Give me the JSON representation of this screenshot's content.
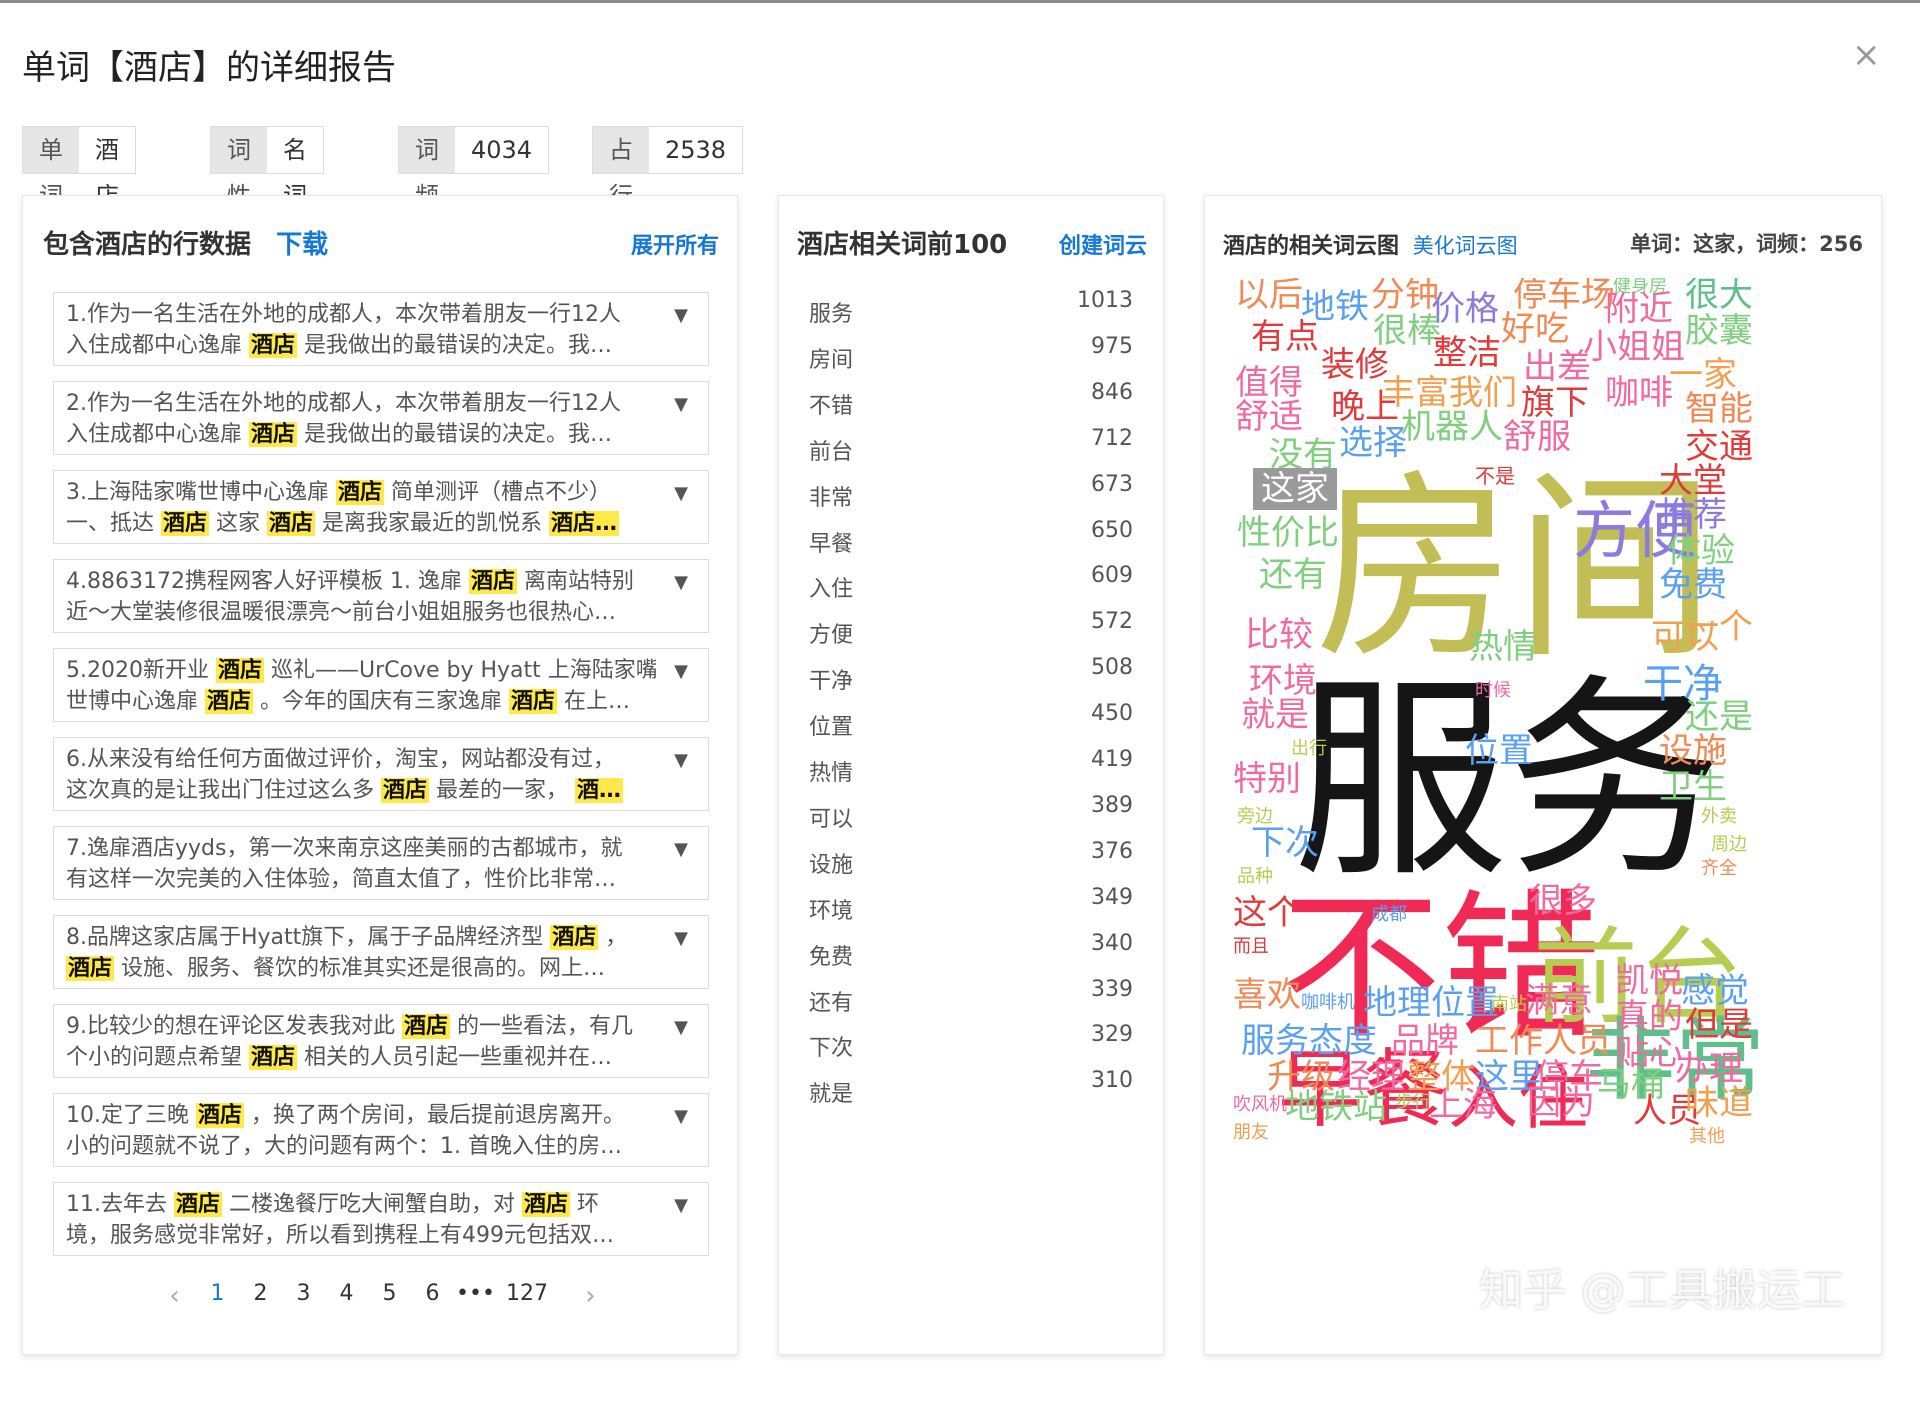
{
  "dialog": {
    "title": "单词【酒店】的详细报告",
    "close": "×"
  },
  "tags": [
    {
      "key": "单词",
      "value": "酒店"
    },
    {
      "key": "词性",
      "value": "名词"
    },
    {
      "key": "词频",
      "value": "4034"
    },
    {
      "key": "占行数",
      "value": "2538"
    }
  ],
  "lines_panel": {
    "title": "包含酒店的行数据",
    "download": "下载",
    "expand_all": "展开所有",
    "rows": [
      {
        "l1": [
          "1.作为一名生活在外地的成都人，本次带着朋友一行12人"
        ],
        "l2": [
          "入住成都中心逸扉 ",
          "#酒店",
          " 是我做出的最错误的决定。我…"
        ]
      },
      {
        "l1": [
          "2.作为一名生活在外地的成都人，本次带着朋友一行12人"
        ],
        "l2": [
          "入住成都中心逸扉 ",
          "#酒店",
          " 是我做出的最错误的决定。我…"
        ]
      },
      {
        "l1": [
          "3.上海陆家嘴世博中心逸扉 ",
          "#酒店",
          " 简单测评（槽点不少）"
        ],
        "l2": [
          "一、抵达 ",
          "#酒店",
          " 这家 ",
          "#酒店",
          " 是离我家最近的凯悦系 ",
          "#酒店…"
        ]
      },
      {
        "l1": [
          "4.8863172携程网客人好评模板 1. 逸扉 ",
          "#酒店",
          " 离南站特别"
        ],
        "l2": [
          "近～大堂装修很温暖很漂亮～前台小姐姐服务也很热心…"
        ]
      },
      {
        "l1": [
          "5.2020新开业 ",
          "#酒店",
          " 巡礼——UrCove by Hyatt 上海陆家嘴"
        ],
        "l2": [
          "世博中心逸扉 ",
          "#酒店",
          " 。今年的国庆有三家逸扉 ",
          "#酒店",
          " 在上…"
        ]
      },
      {
        "l1": [
          "6.从来没有给任何方面做过评价，淘宝，网站都没有过，"
        ],
        "l2": [
          "这次真的是让我出门住过这么多 ",
          "#酒店",
          " 最差的一家， ",
          "#酒…"
        ]
      },
      {
        "l1": [
          "7.逸扉酒店yyds，第一次来南京这座美丽的古都城市，就"
        ],
        "l2": [
          "有这样一次完美的入住体验，简直太值了，性价比非常…"
        ]
      },
      {
        "l1": [
          "8.品牌这家店属于Hyatt旗下，属于子品牌经济型 ",
          "#酒店",
          " ，"
        ],
        "l2": [
          "#酒店",
          " 设施、服务、餐饮的标准其实还是很高的。网上…"
        ]
      },
      {
        "l1": [
          "9.比较少的想在评论区发表我对此 ",
          "#酒店",
          " 的一些看法，有几"
        ],
        "l2": [
          "个小的问题点希望 ",
          "#酒店",
          " 相关的人员引起一些重视并在…"
        ]
      },
      {
        "l1": [
          "10.定了三晚 ",
          "#酒店",
          " ，换了两个房间，最后提前退房离开。"
        ],
        "l2": [
          "小的问题就不说了，大的问题有两个：1. 首晚入住的房…"
        ]
      },
      {
        "l1": [
          "11.去年去 ",
          "#酒店",
          " 二楼逸餐厅吃大闸蟹自助，对 ",
          "#酒店",
          " 环"
        ],
        "l2": [
          "境，服务感觉非常好，所以看到携程上有499元包括双…"
        ]
      }
    ],
    "pagination": {
      "prev": "‹",
      "pages": [
        "1",
        "2",
        "3",
        "4",
        "5",
        "6",
        "•••",
        "127"
      ],
      "next": "›",
      "current": "1"
    }
  },
  "related_panel": {
    "title": "酒店相关词前100",
    "create_cloud": "创建词云",
    "words": [
      {
        "word": "服务",
        "count": "1013"
      },
      {
        "word": "房间",
        "count": "975"
      },
      {
        "word": "不错",
        "count": "846"
      },
      {
        "word": "前台",
        "count": "712"
      },
      {
        "word": "非常",
        "count": "673"
      },
      {
        "word": "早餐",
        "count": "650"
      },
      {
        "word": "入住",
        "count": "609"
      },
      {
        "word": "方便",
        "count": "572"
      },
      {
        "word": "干净",
        "count": "508"
      },
      {
        "word": "位置",
        "count": "450"
      },
      {
        "word": "热情",
        "count": "419"
      },
      {
        "word": "可以",
        "count": "389"
      },
      {
        "word": "设施",
        "count": "376"
      },
      {
        "word": "环境",
        "count": "349"
      },
      {
        "word": "免费",
        "count": "340"
      },
      {
        "word": "还有",
        "count": "339"
      },
      {
        "word": "下次",
        "count": "329"
      },
      {
        "word": "就是",
        "count": "310"
      }
    ]
  },
  "cloud_panel": {
    "title": "酒店的相关词云图",
    "beautify": "美化词云图",
    "hover_info": "单词：这家，词频：256",
    "hovered_word": "这家",
    "watermark": "知乎 @工具搬运工",
    "words": [
      {
        "t": "房间",
        "c": "#c2bd55"
      },
      {
        "t": "服务",
        "c": "#151515"
      },
      {
        "t": "不错",
        "c": "#ee2a55"
      },
      {
        "t": "前台",
        "c": "#b5cd50"
      },
      {
        "t": "早餐",
        "c": "#ee2a55"
      },
      {
        "t": "入住",
        "c": "#ee2a55"
      },
      {
        "t": "非常",
        "c": "#5fbf8a"
      },
      {
        "t": "方便",
        "c": "#8a7be0"
      },
      {
        "t": "以后",
        "c": "#f08a55"
      },
      {
        "t": "地铁",
        "c": "#5aa0f0"
      },
      {
        "t": "分钟",
        "c": "#f08a55"
      },
      {
        "t": "价格",
        "c": "#8a7be0"
      },
      {
        "t": "停车场",
        "c": "#f08a55"
      },
      {
        "t": "健身房",
        "c": "#7fcf7f"
      },
      {
        "t": "很大",
        "c": "#5fbf8a"
      },
      {
        "t": "有点",
        "c": "#e03a3a"
      },
      {
        "t": "很棒",
        "c": "#7fcf7f"
      },
      {
        "t": "好吃",
        "c": "#f08a55"
      },
      {
        "t": "附近",
        "c": "#f06aa0"
      },
      {
        "t": "胶囊",
        "c": "#7fcf7f"
      },
      {
        "t": "装修",
        "c": "#e03a3a"
      },
      {
        "t": "整洁",
        "c": "#e03a3a"
      },
      {
        "t": "出差",
        "c": "#f06aa0"
      },
      {
        "t": "小姐姐",
        "c": "#f06aa0"
      },
      {
        "t": "值得",
        "c": "#f06aa0"
      },
      {
        "t": "丰富",
        "c": "#f0a050"
      },
      {
        "t": "我们",
        "c": "#f0a050"
      },
      {
        "t": "旗下",
        "c": "#e03a3a"
      },
      {
        "t": "咖啡",
        "c": "#f06aa0"
      },
      {
        "t": "一家",
        "c": "#f0a050"
      },
      {
        "t": "舒适",
        "c": "#f06aa0"
      },
      {
        "t": "晚上",
        "c": "#e03a3a"
      },
      {
        "t": "机器人",
        "c": "#7fcf7f"
      },
      {
        "t": "舒服",
        "c": "#f06aa0"
      },
      {
        "t": "智能",
        "c": "#f08a55"
      },
      {
        "t": "没有",
        "c": "#7fcf7f"
      },
      {
        "t": "选择",
        "c": "#5aa0f0"
      },
      {
        "t": "交通",
        "c": "#e03a3a"
      },
      {
        "t": "这家",
        "c": "#ffffff"
      },
      {
        "t": "不是",
        "c": "#e03a3a"
      },
      {
        "t": "大堂",
        "c": "#e03a3a"
      },
      {
        "t": "性价比",
        "c": "#7fcf7f"
      },
      {
        "t": "推荐",
        "c": "#8a7be0"
      },
      {
        "t": "体验",
        "c": "#7fcf7f"
      },
      {
        "t": "还有",
        "c": "#7fcf7f"
      },
      {
        "t": "免费",
        "c": "#5aa0f0"
      },
      {
        "t": "一个",
        "c": "#f0a050"
      },
      {
        "t": "比较",
        "c": "#f06aa0"
      },
      {
        "t": "热情",
        "c": "#7fcf7f"
      },
      {
        "t": "可以",
        "c": "#f0a050"
      },
      {
        "t": "环境",
        "c": "#f06aa0"
      },
      {
        "t": "时候",
        "c": "#f06aa0"
      },
      {
        "t": "干净",
        "c": "#5aa0f0"
      },
      {
        "t": "就是",
        "c": "#f06aa0"
      },
      {
        "t": "还是",
        "c": "#7fcf7f"
      },
      {
        "t": "出行",
        "c": "#b5cd50"
      },
      {
        "t": "位置",
        "c": "#5aa0f0"
      },
      {
        "t": "设施",
        "c": "#f08a55"
      },
      {
        "t": "特别",
        "c": "#f06aa0"
      },
      {
        "t": "卫生",
        "c": "#7fcf7f"
      },
      {
        "t": "旁边",
        "c": "#b5cd50"
      },
      {
        "t": "外卖",
        "c": "#b5cd50"
      },
      {
        "t": "下次",
        "c": "#5aa0f0"
      },
      {
        "t": "周边",
        "c": "#b5cd50"
      },
      {
        "t": "品种",
        "c": "#b5cd50"
      },
      {
        "t": "齐全",
        "c": "#f08a55"
      },
      {
        "t": "很多",
        "c": "#f06aa0"
      },
      {
        "t": "这个",
        "c": "#e03a3a"
      },
      {
        "t": "成都",
        "c": "#5aa0f0"
      },
      {
        "t": "而且",
        "c": "#e03a3a"
      },
      {
        "t": "凯悦",
        "c": "#f06aa0"
      },
      {
        "t": "感觉",
        "c": "#5aa0f0"
      },
      {
        "t": "喜欢",
        "c": "#f08a55"
      },
      {
        "t": "咖啡机",
        "c": "#5aa0f0"
      },
      {
        "t": "地理位置",
        "c": "#5aa0f0"
      },
      {
        "t": "南站",
        "c": "#b5cd50"
      },
      {
        "t": "满意",
        "c": "#f06aa0"
      },
      {
        "t": "真的",
        "c": "#f06aa0"
      },
      {
        "t": "但是",
        "c": "#e03a3a"
      },
      {
        "t": "服务态度",
        "c": "#5aa0f0"
      },
      {
        "t": "品牌",
        "c": "#f06aa0"
      },
      {
        "t": "工作人员",
        "c": "#f08a55"
      },
      {
        "t": "贴心",
        "c": "#f06aa0"
      },
      {
        "t": "升级",
        "c": "#f08a55"
      },
      {
        "t": "经理",
        "c": "#f06aa0"
      },
      {
        "t": "整体",
        "c": "#f0a050"
      },
      {
        "t": "这里",
        "c": "#5aa0f0"
      },
      {
        "t": "停车",
        "c": "#f06aa0"
      },
      {
        "t": "马桶",
        "c": "#7fcf7f"
      },
      {
        "t": "办理",
        "c": "#f06aa0"
      },
      {
        "t": "吹风机",
        "c": "#f06aa0"
      },
      {
        "t": "地铁站",
        "c": "#7fcf7f"
      },
      {
        "t": "步行",
        "c": "#b5cd50"
      },
      {
        "t": "上海",
        "c": "#f06aa0"
      },
      {
        "t": "因为",
        "c": "#f06aa0"
      },
      {
        "t": "人员",
        "c": "#e03a3a"
      },
      {
        "t": "味道",
        "c": "#f0a050"
      },
      {
        "t": "朋友",
        "c": "#f0a050"
      },
      {
        "t": "其他",
        "c": "#f0a050"
      }
    ]
  }
}
